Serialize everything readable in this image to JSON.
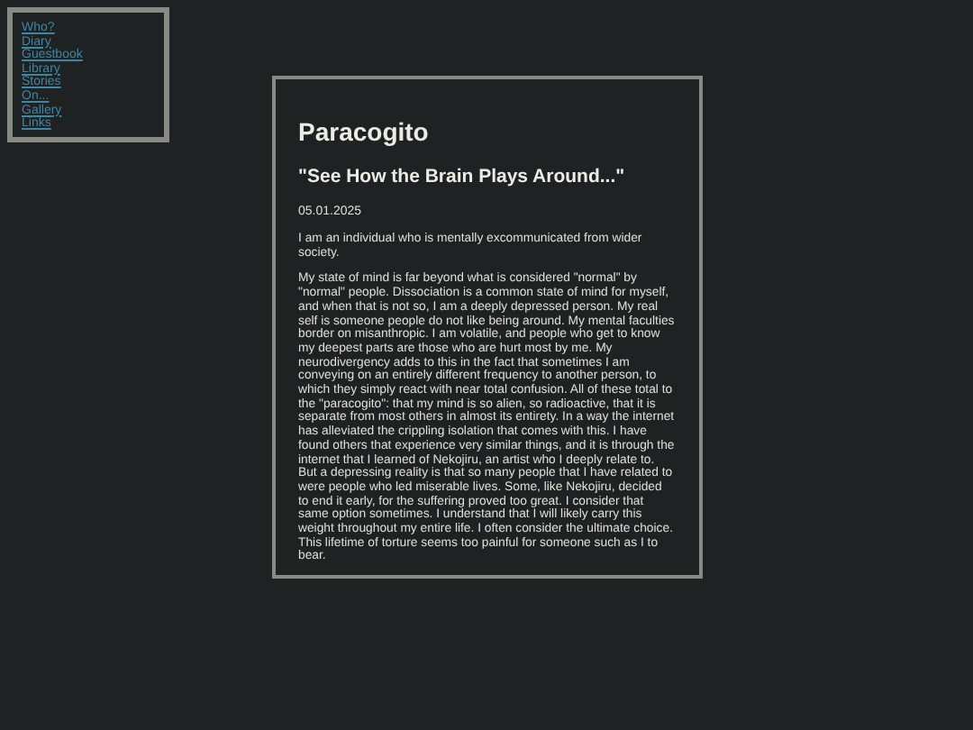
{
  "nav": {
    "links": [
      "Who?",
      "Diary",
      "Guestbook",
      "Library",
      "Stories",
      "On...",
      "Gallery",
      "Links"
    ]
  },
  "post": {
    "title": "Paracogito",
    "subtitle": "\"See How the Brain Plays Around...\"",
    "date": "05.01.2025",
    "paragraphs": [
      "I am an individual who is mentally excommunicated from wider society.",
      "My state of mind is far beyond what is considered \"normal\" by \"normal\" people. Dissociation is a common state of mind for myself, and when that is not so, I am a deeply depressed person. My real self is someone people do not like being around. My mental faculties border on misanthropic. I am volatile, and people who get to know my deepest parts are those who are hurt most by me. My neurodivergency adds to this in the fact that sometimes I am conveying on an entirely different frequency to another person, to which they simply react with near total confusion. All of these total to the \"paracogito\": that my mind is so alien, so radioactive, that it is separate from most others in almost its entirety. In a way the internet has alleviated the crippling isolation that comes with this. I have found others that experience very similar things, and it is through the internet that I learned of Nekojiru, an artist who I deeply relate to. But a depressing reality is that so many people that I have related to were people who led miserable lives. Some, like Nekojiru, decided to end it early, for the suffering proved too great. I consider that same option sometimes. I understand that I will likely carry this weight throughout my entire life. I often consider the ultimate choice. This lifetime of torture seems too painful for someone such as I to bear."
    ]
  }
}
